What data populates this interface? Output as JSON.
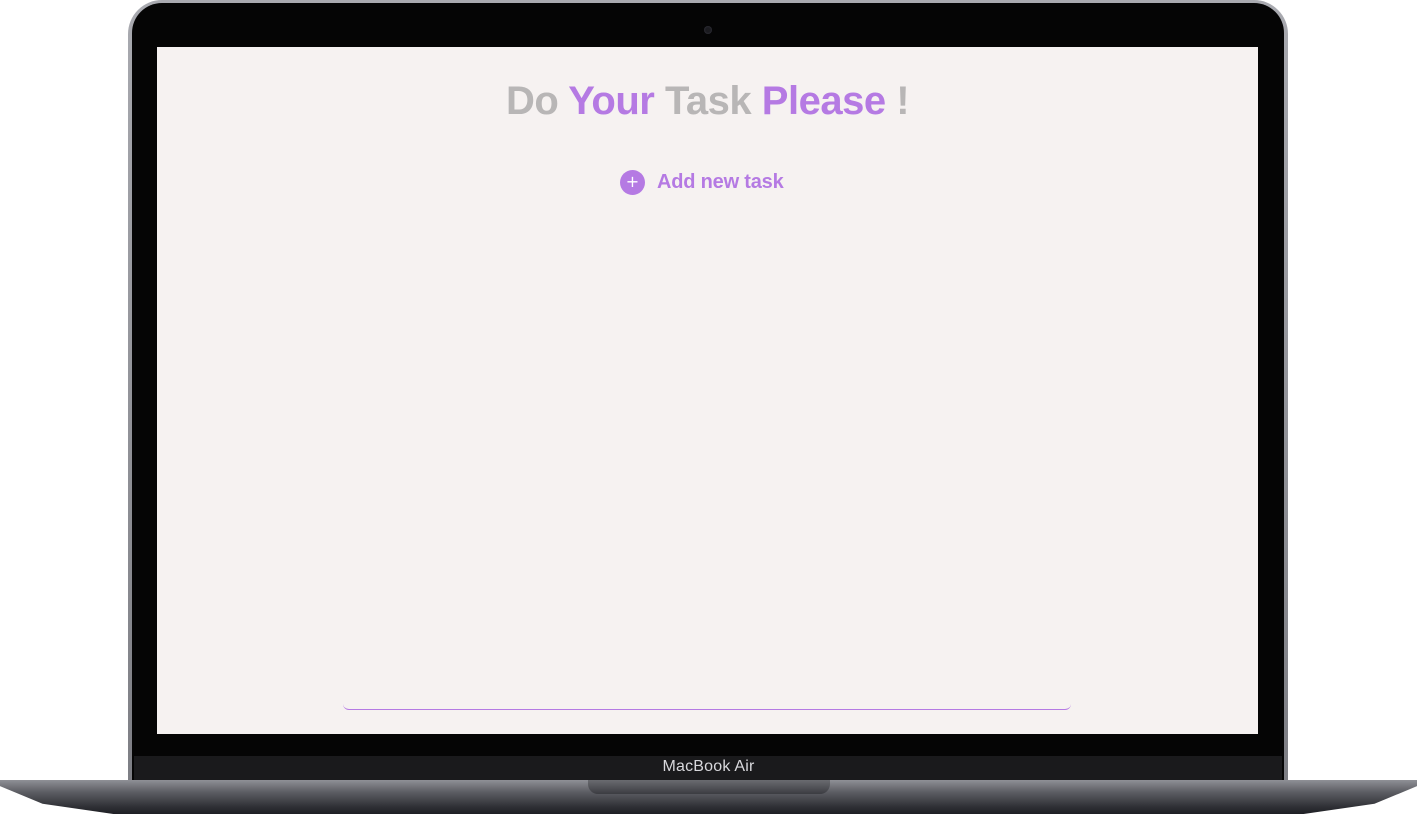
{
  "device": {
    "brand_label": "MacBook Air"
  },
  "title": {
    "parts": [
      "Do",
      "Your",
      "Task",
      "Please",
      "!"
    ]
  },
  "add_task": {
    "label": "Add new task",
    "icon": "plus-circle-icon",
    "icon_glyph": "+"
  },
  "task_input": {
    "value": "",
    "placeholder": ""
  },
  "colors": {
    "accent": "#b57ae3",
    "muted": "#b8b6b6",
    "background": "#f6f2f1"
  }
}
